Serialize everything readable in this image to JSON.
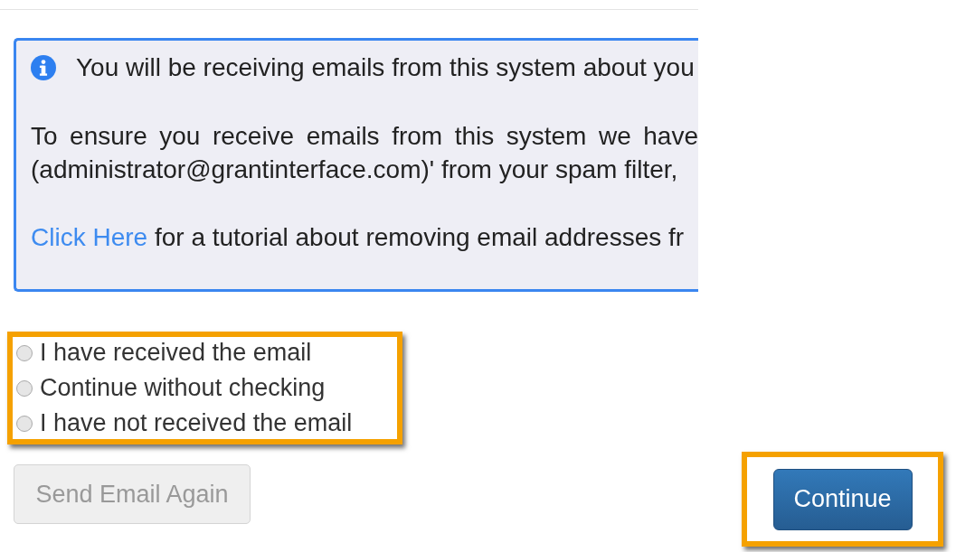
{
  "info_box": {
    "heading": "You will be receiving emails from this system about you",
    "paragraph_lines": [
      "To ensure you receive emails from this system we have",
      "(administrator@grantinterface.com)' from your spam filter,"
    ],
    "link": "Click Here",
    "link_rest": "for a tutorial about removing email addresses fr"
  },
  "radio_group": {
    "highlighted": true,
    "options": [
      {
        "label": "I have received the email",
        "selected": false
      },
      {
        "label": "Continue without checking",
        "selected": false
      },
      {
        "label": "I have not received the email",
        "selected": false
      }
    ]
  },
  "send_again_button": {
    "label": "Send Email Again",
    "disabled": true
  },
  "continue_button": {
    "label": "Continue",
    "disabled": false,
    "highlighted": true
  }
}
